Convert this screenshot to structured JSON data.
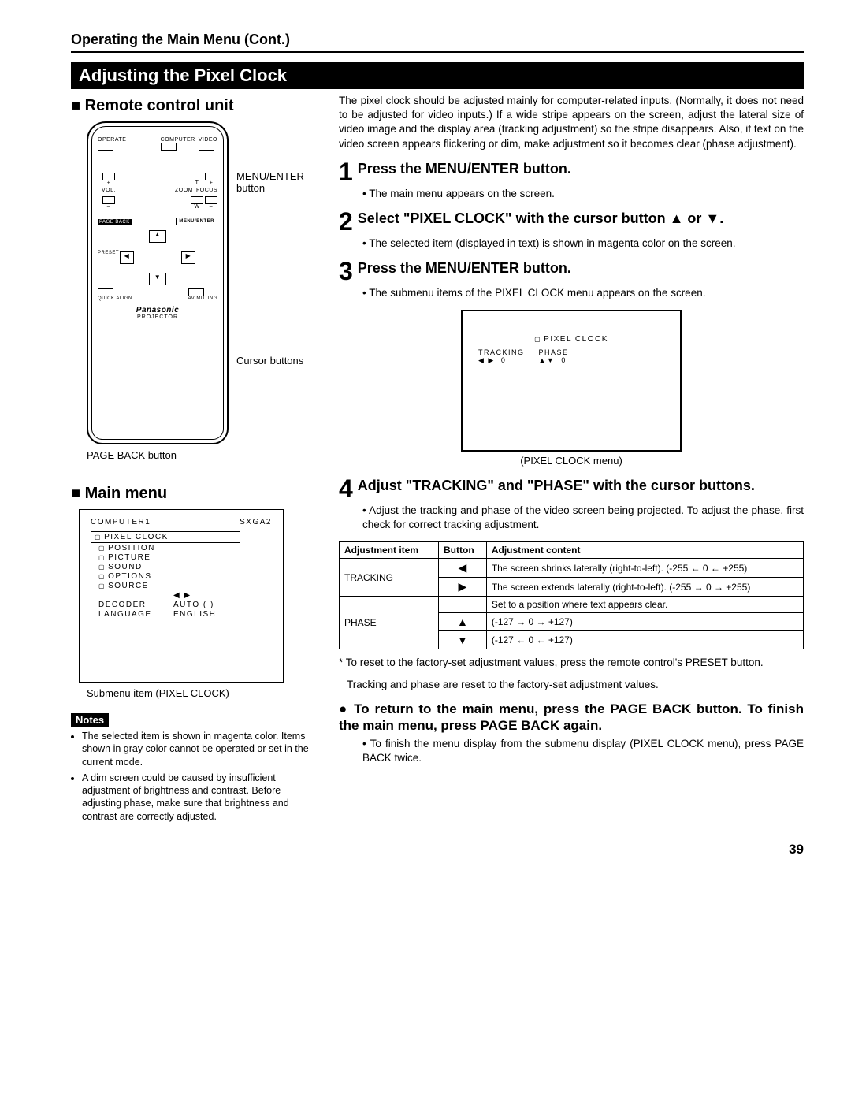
{
  "header": "Operating the Main Menu (Cont.)",
  "section_bar": "Adjusting the Pixel Clock",
  "left": {
    "remote_heading": "Remote control unit",
    "callouts": {
      "menu_enter": "MENU/ENTER button",
      "cursor": "Cursor buttons",
      "page_back": "PAGE BACK button"
    },
    "remote": {
      "operate": "OPERATE",
      "computer": "COMPUTER",
      "video": "VIDEO",
      "vol": "VOL.",
      "zoom": "ZOOM",
      "focus": "FOCUS",
      "t": "T",
      "w": "W",
      "plus": "+",
      "minus": "–",
      "page_back": "PAGE BACK",
      "menu_enter": "MENU/ENTER",
      "preset": "PRESET",
      "quick_align": "QUICK ALIGN.",
      "av_muting": "AV MUTING",
      "brand": "Panasonic",
      "projector": "PROJECTOR"
    },
    "main_menu_heading": "Main menu",
    "menu": {
      "computer1": "COMPUTER1",
      "sxga2": "SXGA2",
      "pixel_clock": "PIXEL CLOCK",
      "position": "POSITION",
      "picture": "PICTURE",
      "sound": "SOUND",
      "options": "OPTIONS",
      "source": "SOURCE",
      "decoder": "DECODER",
      "auto": "AUTO (        )",
      "language": "LANGUAGE",
      "english": "ENGLISH",
      "arrows": "◀ ▶"
    },
    "submenu_cap": "Submenu item (PIXEL CLOCK)",
    "notes_label": "Notes",
    "notes": [
      "The selected item is shown in magenta color. Items shown in gray color cannot be operated or set in the current mode.",
      "A dim screen could be caused by insufficient adjustment of brightness and contrast. Before adjusting phase, make sure that brightness and contrast are correctly adjusted."
    ]
  },
  "right": {
    "intro": "The pixel clock should be adjusted mainly for computer-related inputs. (Normally, it does not need to be adjusted for video inputs.) If a wide stripe appears on the screen, adjust the lateral size of video image and the display area (tracking adjustment) so the stripe disappears. Also, if text on the video screen appears flickering or dim, make adjustment so it becomes clear (phase adjustment).",
    "step1": {
      "title": "Press the MENU/ENTER button.",
      "bullet": "The main menu appears on the screen."
    },
    "step2": {
      "title": "Select \"PIXEL CLOCK\" with the cursor button ▲ or ▼.",
      "bullet": "The selected item (displayed in text) is shown in magenta color on the screen."
    },
    "step3": {
      "title": "Press the MENU/ENTER button.",
      "bullet": "The submenu items of the PIXEL CLOCK menu appears on the screen."
    },
    "screen": {
      "title": "PIXEL CLOCK",
      "tracking": "TRACKING",
      "phase": "PHASE",
      "tval": "0",
      "pval": "0",
      "tarrows": "◀ ▶",
      "parrows": "▲▼",
      "caption": "(PIXEL CLOCK menu)"
    },
    "step4": {
      "title": "Adjust \"TRACKING\" and \"PHASE\" with the cursor buttons.",
      "bullet": "Adjust the tracking and phase of the video screen being projected. To adjust the phase, first check for correct tracking adjustment."
    },
    "table": {
      "h1": "Adjustment item",
      "h2": "Button",
      "h3": "Adjustment content",
      "tracking": "TRACKING",
      "phase": "PHASE",
      "r1c": "The screen shrinks laterally (right-to-left). (-255 ← 0 ← +255)",
      "r2c": "The screen extends laterally (right-to-left). (-255 → 0 → +255)",
      "r3c": "Set to a position where text appears clear.",
      "r4c": "(-127 → 0 → +127)",
      "r5c": "(-127 ← 0 ← +127)",
      "left_arrow": "◀",
      "right_arrow": "▶",
      "up_arrow": "▲",
      "down_arrow": "▼"
    },
    "footnote1": "* To reset to the factory-set adjustment values, press the remote control's PRESET button.",
    "footnote2": "Tracking and phase are reset to the factory-set adjustment values.",
    "return_hdr": "To return to the main menu, press the PAGE BACK button. To finish the main menu, press PAGE BACK again.",
    "return_bul": "To finish the menu display from the submenu display (PIXEL CLOCK menu), press PAGE BACK twice."
  },
  "page_number": "39"
}
